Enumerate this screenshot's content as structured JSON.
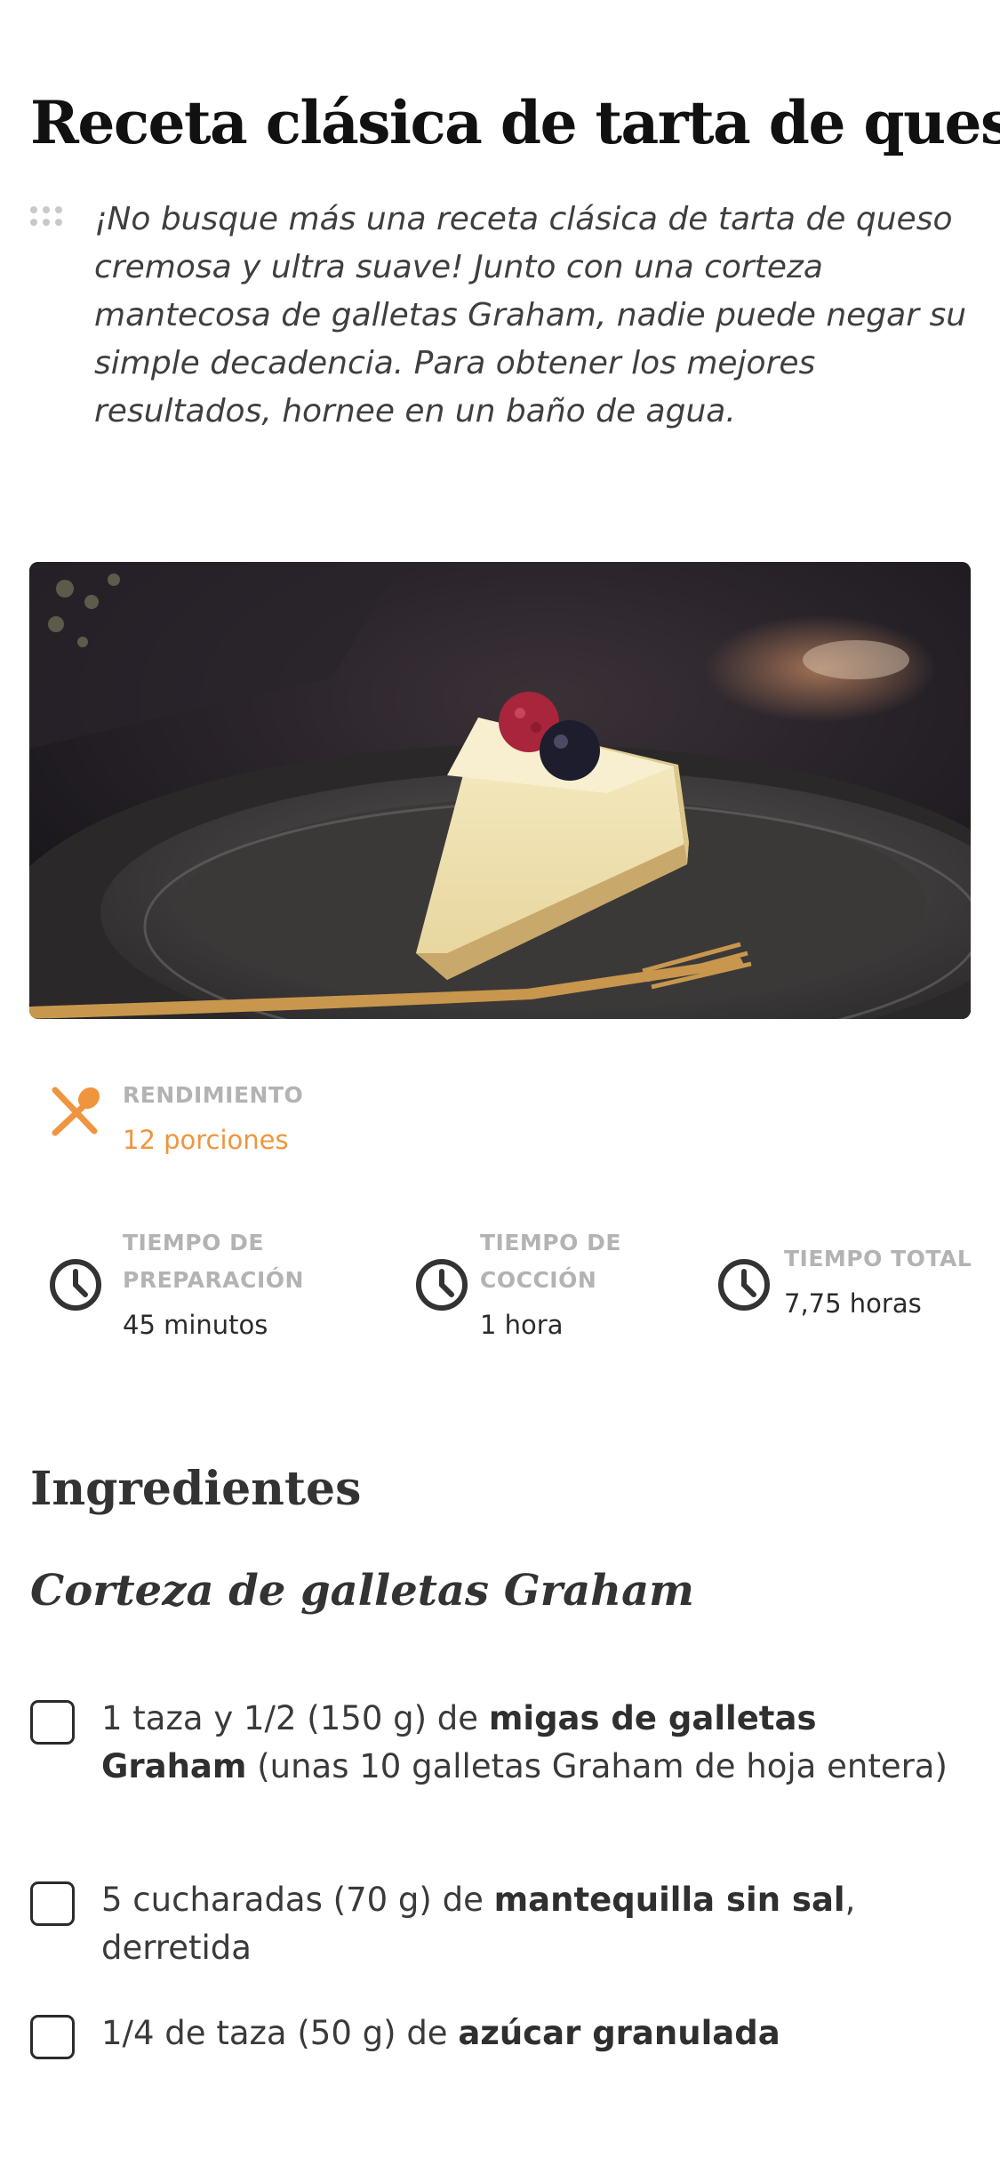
{
  "recipe": {
    "title": "Receta clásica de tarta de queso",
    "description": "¡No busque más una receta clásica de tarta de queso cremosa y ultra suave! Junto con una corteza mantecosa de galletas Graham, nadie puede negar su simple decadencia. Para obtener los mejores resultados, hornee en un baño de agua."
  },
  "yield": {
    "icon": "utensils-icon",
    "label": "RENDIMIENTO",
    "value": "12 porciones"
  },
  "times": [
    {
      "icon": "clock-icon",
      "label_line1": "TIEMPO DE",
      "label_line2": "PREPARACIÓN",
      "value": "45 minutos"
    },
    {
      "icon": "clock-icon",
      "label_line1": "TIEMPO DE",
      "label_line2": "COCCIÓN",
      "value": "1 hora"
    },
    {
      "icon": "clock-icon",
      "label_line1": "TIEMPO TOTAL",
      "label_line2": "",
      "value": "7,75 horas"
    }
  ],
  "ingredients": {
    "heading": "Ingredientes",
    "group_title": "Corteza de galletas Graham",
    "items": [
      {
        "pre": "1 taza y 1/2 (150 g) de ",
        "bold": "migas de galletas Graham",
        "post": " (unas 10 galletas Graham de hoja entera)"
      },
      {
        "pre": "5 cucharadas (70 g) de ",
        "bold": "mantequilla sin sal",
        "post": ", derretida"
      },
      {
        "pre": "1/4 de taza (50 g) de ",
        "bold": "azúcar granulada",
        "post": ""
      }
    ]
  },
  "colors": {
    "accent": "#f0953f",
    "label_gray": "#b3b3b3",
    "text_dark": "#333333"
  }
}
